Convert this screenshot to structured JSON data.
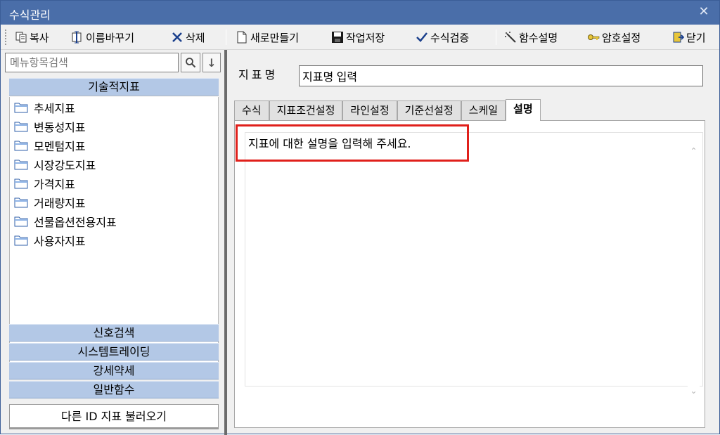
{
  "window": {
    "title": "수식관리",
    "close_glyph": "✕"
  },
  "toolbar": {
    "copy_label": "복사",
    "rename_label": "이름바꾸기",
    "delete_label": "삭제",
    "new_label": "새로만들기",
    "save_label": "작업저장",
    "verify_label": "수식검증",
    "func_desc_label": "함수설명",
    "password_label": "암호설정",
    "close_label": "닫기"
  },
  "sidebar": {
    "search_placeholder": "메뉴항목검색",
    "down_glyph": "↓",
    "category_top": "기술적지표",
    "items": [
      {
        "label": "추세지표"
      },
      {
        "label": "변동성지표"
      },
      {
        "label": "모멘텀지표"
      },
      {
        "label": "시장강도지표"
      },
      {
        "label": "가격지표"
      },
      {
        "label": "거래량지표"
      },
      {
        "label": "선물옵션전용지표"
      },
      {
        "label": "사용자지표"
      }
    ],
    "categories_bottom": [
      {
        "label": "신호검색"
      },
      {
        "label": "시스템트레이딩"
      },
      {
        "label": "강세약세"
      },
      {
        "label": "일반함수"
      }
    ],
    "load_other_label": "다른 ID 지표 불러오기"
  },
  "main": {
    "name_label": "지표명",
    "name_value": "지표명 입력",
    "tabs": [
      {
        "label": "수식"
      },
      {
        "label": "지표조건설정"
      },
      {
        "label": "라인설정"
      },
      {
        "label": "기준선설정"
      },
      {
        "label": "스케일"
      },
      {
        "label": "설명"
      }
    ],
    "active_tab": "설명",
    "description_text": "지표에 대한 설명을 입력해 주세요."
  },
  "colors": {
    "titlebar": "#4a6ea9",
    "category_header": "#b3c8e6",
    "highlight": "#e0201b"
  }
}
